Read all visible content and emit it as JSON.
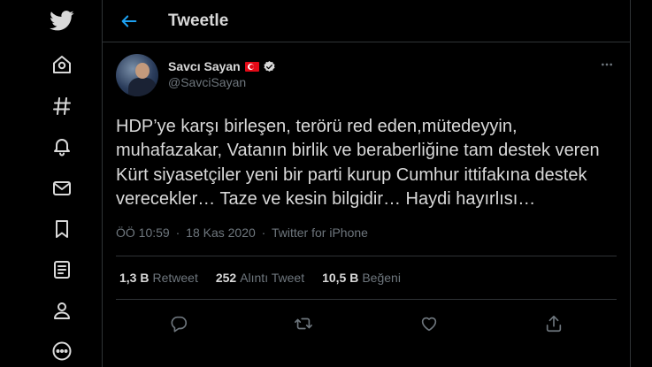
{
  "header": {
    "title": "Tweetle"
  },
  "nav": {
    "icons": [
      "twitter-logo-icon",
      "explore-icon",
      "hashtag-icon",
      "notifications-bell-icon",
      "messages-mail-icon",
      "bookmark-icon",
      "lists-icon",
      "profile-icon",
      "more-circle-icon"
    ]
  },
  "tweet": {
    "display_name": "Savcı Sayan",
    "handle": "@SavciSayan",
    "text": "HDP’ye karşı birleşen, terörü red eden,mütedeyyin, muhafazakar, Vatanın birlik ve beraberliğine tam destek veren Kürt siyasetçiler yeni bir parti kurup Cumhur ittifakına destek verecekler… Taze ve kesin bilgidir… Haydi hayırlısı…",
    "time": "ÖÖ 10:59",
    "date": "18 Kas 2020",
    "separator": "·",
    "source": "Twitter for iPhone",
    "stats": {
      "retweets_count": "1,3 B",
      "retweets_label": "Retweet",
      "quotes_count": "252",
      "quotes_label": "Alıntı Tweet",
      "likes_count": "10,5 B",
      "likes_label": "Beğeni"
    }
  },
  "colors": {
    "accent": "#1da1f2",
    "background": "#000000",
    "muted": "#6e767d",
    "border": "#2f3336",
    "text": "#d9d9d9"
  }
}
